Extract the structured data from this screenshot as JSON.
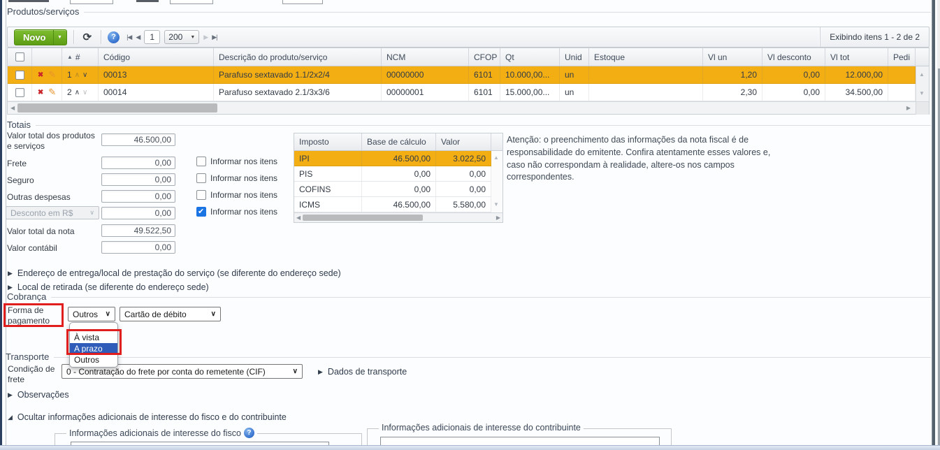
{
  "icons": {
    "dropdown": "▼",
    "refresh": "⟳",
    "help": "?",
    "pager_first": "|◀",
    "pager_prev": "◀",
    "pager_next": "▶",
    "pager_last": "▶|",
    "sort_asc": "▲",
    "row_up": "∧",
    "row_down": "∨",
    "delete": "✖",
    "edit": "✎",
    "select_arrow": "∨",
    "collapsed": "▶",
    "expanded": "◢",
    "check": "✔",
    "scroll_left": "◀",
    "scroll_right": "▶",
    "scroll_up": "▲",
    "scroll_down": "▼"
  },
  "colors": {
    "row_highlight": "#F2AE13",
    "selected_option": "#2E5CB8",
    "annotation_red": "#E01E1E",
    "novo_green": "#5C9D13",
    "checkbox_blue": "#1B74E4",
    "help_blue": "#3672CF"
  },
  "produtos": {
    "legend": "Produtos/serviços",
    "toolbar": {
      "new_button": "Novo",
      "page_number": "1",
      "page_size": "200",
      "status": "Exibindo itens 1 - 2 de 2"
    },
    "grid": {
      "columns": {
        "sort": "#",
        "codigo": "Código",
        "descricao": "Descrição do produto/serviço",
        "ncm": "NCM",
        "cfop": "CFOP",
        "qt": "Qt",
        "unid": "Unid",
        "estoque": "Estoque",
        "vl_un": "Vl un",
        "vl_desconto": "Vl desconto",
        "vl_tot": "Vl tot",
        "pedido": "Pedi"
      },
      "rows": [
        {
          "num": "1",
          "codigo": "00013",
          "descricao": "Parafuso sextavado 1.1/2x2/4",
          "ncm": "00000000",
          "cfop": "6101",
          "qt": "10.000,00...",
          "unid": "un",
          "estoque": "",
          "vl_un": "1,20",
          "vl_desconto": "0,00",
          "vl_tot": "12.000,00",
          "highlighted": true
        },
        {
          "num": "2",
          "codigo": "00014",
          "descricao": "Parafuso sextavado 2.1/3x3/6",
          "ncm": "00000001",
          "cfop": "6101",
          "qt": "15.000,00...",
          "unid": "un",
          "estoque": "",
          "vl_un": "2,30",
          "vl_desconto": "0,00",
          "vl_tot": "34.500,00",
          "highlighted": false
        }
      ]
    }
  },
  "totais": {
    "legend": "Totais",
    "informar_label": "Informar nos itens",
    "valor_total_produtos": {
      "label": "Valor total dos produtos e serviços",
      "value": "46.500,00"
    },
    "frete": {
      "label": "Frete",
      "value": "0,00",
      "informar": false
    },
    "seguro": {
      "label": "Seguro",
      "value": "0,00",
      "informar": false
    },
    "outras_despesas": {
      "label": "Outras despesas",
      "value": "0,00",
      "informar": false
    },
    "desconto": {
      "select_value": "Desconto em R$",
      "value": "0,00",
      "informar": true
    },
    "valor_total_nota": {
      "label": "Valor total da nota",
      "value": "49.522,50"
    },
    "valor_contabil": {
      "label": "Valor contábil",
      "value": "0,00"
    }
  },
  "impostos": {
    "columns": {
      "imposto": "Imposto",
      "base": "Base de cálculo",
      "valor": "Valor"
    },
    "rows": [
      {
        "nome": "IPI",
        "base": "46.500,00",
        "valor": "3.022,50",
        "highlighted": true
      },
      {
        "nome": "PIS",
        "base": "0,00",
        "valor": "0,00",
        "highlighted": false
      },
      {
        "nome": "COFINS",
        "base": "0,00",
        "valor": "0,00",
        "highlighted": false
      },
      {
        "nome": "ICMS",
        "base": "46.500,00",
        "valor": "5.580,00",
        "highlighted": false
      }
    ]
  },
  "aviso": "Atenção: o preenchimento das informações da nota fiscal é de responsabilidade do emitente. Confira atentamente esses valores e, caso não correspondam à realidade, altere-os nos campos correspondentes.",
  "secoes": {
    "endereco_entrega": "Endereço de entrega/local de prestação do serviço (se diferente do endereço sede)",
    "local_retirada": "Local de retirada (se diferente do endereço sede)",
    "observacoes": "Observações",
    "ocultar_info": "Ocultar informações adicionais de interesse do fisco e do contribuinte"
  },
  "cobranca": {
    "legend": "Cobrança",
    "forma_pagamento_label": "Forma de pagamento",
    "meio_select": "Outros",
    "tipo_select": "Cartão de débito",
    "dropdown_options": [
      "À vista",
      "A prazo",
      "Outros"
    ],
    "dropdown_selected": "A prazo"
  },
  "transporte": {
    "legend": "Transporte",
    "condicao_label": "Condição de frete",
    "condicao_value": "0 - Contratação do frete por conta do remetente (CIF)",
    "dados_link": "Dados de transporte"
  },
  "info_adicionais": {
    "fisco_legend": "Informações adicionais de interesse do fisco",
    "fisco_value": "",
    "contribuinte_legend": "Informações adicionais de interesse do contribuinte",
    "contribuinte_value": ""
  }
}
